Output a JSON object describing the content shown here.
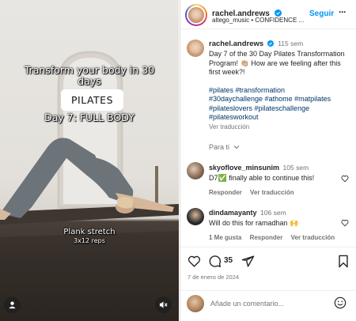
{
  "media": {
    "headline": "Transform your body in 30 days",
    "pill": "PILATES",
    "dayline": "Day 7: FULL BODY",
    "exercise": "Plank stretch",
    "reps": "3x12 reps"
  },
  "header": {
    "username": "rachel.andrews",
    "subtitle": "altego_music • CONFIDENCE ...",
    "follow_label": "Seguir",
    "more_label": "···"
  },
  "caption": {
    "username": "rachel.andrews",
    "time": "115 sem",
    "text": "Day 7 of the 30 Day Pilates Transformation Program! 👏🏼 How are we feeling after this first week?!",
    "hashtags_line1": "#pilates #transformation",
    "hashtags_line2": "#30daychallenge #athome #matpilates",
    "hashtags_line3": "#pilateslovers #pilateschallenge",
    "hashtags_line4": "#pilatesworkout",
    "translate": "Ver traducción",
    "for_you": "Para ti"
  },
  "comments": [
    {
      "username": "skyoflove_minsunim",
      "time": "105 sem",
      "text": "D7✅ finally able to continue this!",
      "reply": "Responder",
      "translate": "Ver traducción"
    },
    {
      "username": "dindamayanty",
      "time": "106 sem",
      "text": "Will do this for ramadhan 🙌",
      "likes": "1 Me gusta",
      "reply": "Responder",
      "translate": "Ver traducción"
    }
  ],
  "actions": {
    "share_count": "35",
    "date": "7 de enero de 2024"
  },
  "add_comment": {
    "placeholder": "Añade un comentario..."
  },
  "colors": {
    "link": "#00376b",
    "follow": "#0095f6",
    "verified": "#0095f6",
    "muted": "#737373"
  }
}
